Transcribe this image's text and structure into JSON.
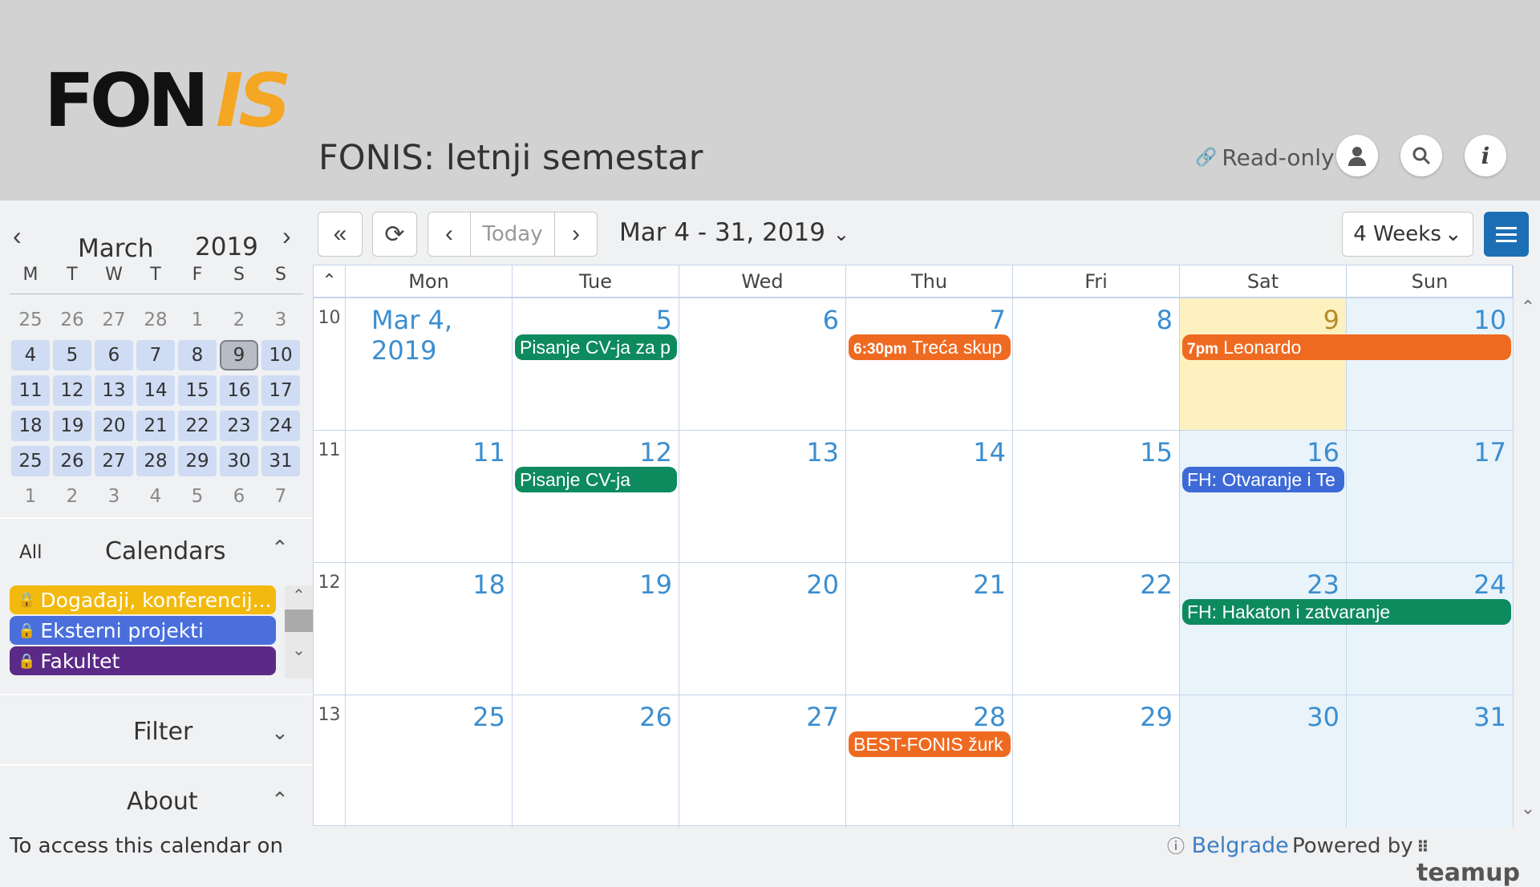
{
  "header": {
    "logo_left": "FON",
    "logo_right": "IS",
    "title": "FONIS: letnji semestar",
    "readonly_label": "Read-only",
    "buttons": [
      "user-icon",
      "search-icon",
      "info-icon"
    ]
  },
  "mini_calendar": {
    "month": "March",
    "year": "2019",
    "dow": [
      "M",
      "T",
      "W",
      "T",
      "F",
      "S",
      "S"
    ],
    "weeks": [
      [
        "25",
        "26",
        "27",
        "28",
        "1",
        "2",
        "3"
      ],
      [
        "4",
        "5",
        "6",
        "7",
        "8",
        "9",
        "10"
      ],
      [
        "11",
        "12",
        "13",
        "14",
        "15",
        "16",
        "17"
      ],
      [
        "18",
        "19",
        "20",
        "21",
        "22",
        "23",
        "24"
      ],
      [
        "25",
        "26",
        "27",
        "28",
        "29",
        "30",
        "31"
      ],
      [
        "1",
        "2",
        "3",
        "4",
        "5",
        "6",
        "7"
      ]
    ]
  },
  "sidebar": {
    "all_label": "All",
    "calendars_title": "Calendars",
    "calendars": [
      {
        "label": "Događaji, konferencij...",
        "color": "#f2b90f"
      },
      {
        "label": "Eksterni projekti",
        "color": "#4a6fdc"
      },
      {
        "label": "Fakultet",
        "color": "#5b2a86"
      }
    ],
    "filter_title": "Filter",
    "about_title": "About",
    "about_text": "To access this calendar on"
  },
  "toolbar": {
    "today_label": "Today",
    "date_range": "Mar 4 - 31, 2019",
    "view_label": "4 Weeks"
  },
  "grid": {
    "day_headers": [
      "Mon",
      "Tue",
      "Wed",
      "Thu",
      "Fri",
      "Sat",
      "Sun"
    ],
    "week_numbers": [
      "10",
      "11",
      "12",
      "13"
    ],
    "weeks": [
      [
        "Mar 4, 2019",
        "5",
        "6",
        "7",
        "8",
        "9",
        "10"
      ],
      [
        "11",
        "12",
        "13",
        "14",
        "15",
        "16",
        "17"
      ],
      [
        "18",
        "19",
        "20",
        "21",
        "22",
        "23",
        "24"
      ],
      [
        "25",
        "26",
        "27",
        "28",
        "29",
        "30",
        "31"
      ]
    ],
    "events": [
      {
        "title": "Pisanje CV-ja za p",
        "time": "",
        "color": "#0e8a5f"
      },
      {
        "title": "Treća skup",
        "time": "6:30pm",
        "color": "#ef6a21"
      },
      {
        "title": "Leonardo",
        "time": "7pm",
        "color": "#ef6a21"
      },
      {
        "title": "Pisanje CV-ja",
        "time": "",
        "color": "#0e8a5f"
      },
      {
        "title": "FH: Otvaranje i Te",
        "time": "",
        "color": "#3d6ad6"
      },
      {
        "title": "FH: Hakaton i zatvaranje",
        "time": "",
        "color": "#0e8a5f"
      },
      {
        "title": "BEST-FONIS žurk",
        "time": "",
        "color": "#ef6a21"
      }
    ]
  },
  "footer": {
    "timezone": "Belgrade",
    "powered_by": "Powered by",
    "brand": "teamup"
  }
}
